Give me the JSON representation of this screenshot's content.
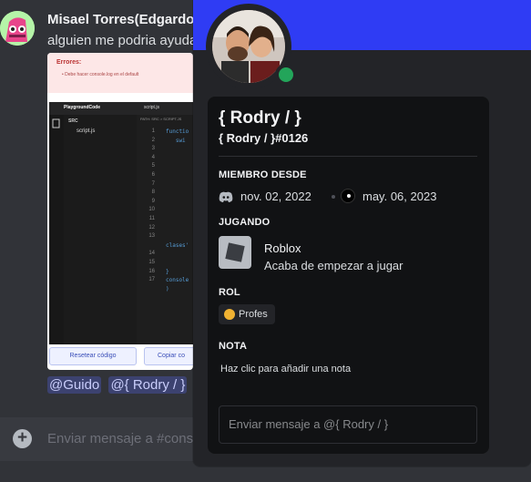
{
  "chat": {
    "message": {
      "author": "Misael Torres(Edgardo)",
      "text": "alguien me podria ayuda"
    },
    "attachment": {
      "error_title": "Errores:",
      "error_item": "Debe hacer console.log en el default",
      "editor_app": "PlaygroundCode",
      "editor_tab": "script.js",
      "folder": "SRC",
      "file": "script.js",
      "path": "PATH: SRC > SCRIPT.JS",
      "line_numbers": "1\n2\n3\n4\n5\n6\n7\n8\n9\n10\n11\n12\n13\n\n14\n15\n16\n17",
      "code": "functio\n   swi\n\n\n\n\n\n\n\n\n\n\n\nclases'\n\n\n}\nconsole\n)",
      "reset_button": "Resetear código",
      "copy_button": "Copiar co"
    },
    "mentions": [
      "@Guido",
      "@{ Rodry / }"
    ],
    "composer_placeholder": "Enviar mensaje a #cons"
  },
  "profile": {
    "display_name": "{ Rodry / }",
    "username": "{ Rodry / }#0126",
    "status_color": "#23a55a",
    "banner_color": "#2f3cf4",
    "member_since_heading": "MIEMBRO DESDE",
    "member_since_discord": "nov. 02, 2022",
    "member_since_server": "may. 06, 2023",
    "playing_heading": "JUGANDO",
    "game_name": "Roblox",
    "game_state": "Acaba de empezar a jugar",
    "role_heading": "ROL",
    "role_name": "Profes",
    "role_color": "#f0b232",
    "note_heading": "NOTA",
    "note_placeholder": "Haz clic para añadir una nota",
    "message_placeholder": "Enviar mensaje a @{ Rodry / }"
  }
}
